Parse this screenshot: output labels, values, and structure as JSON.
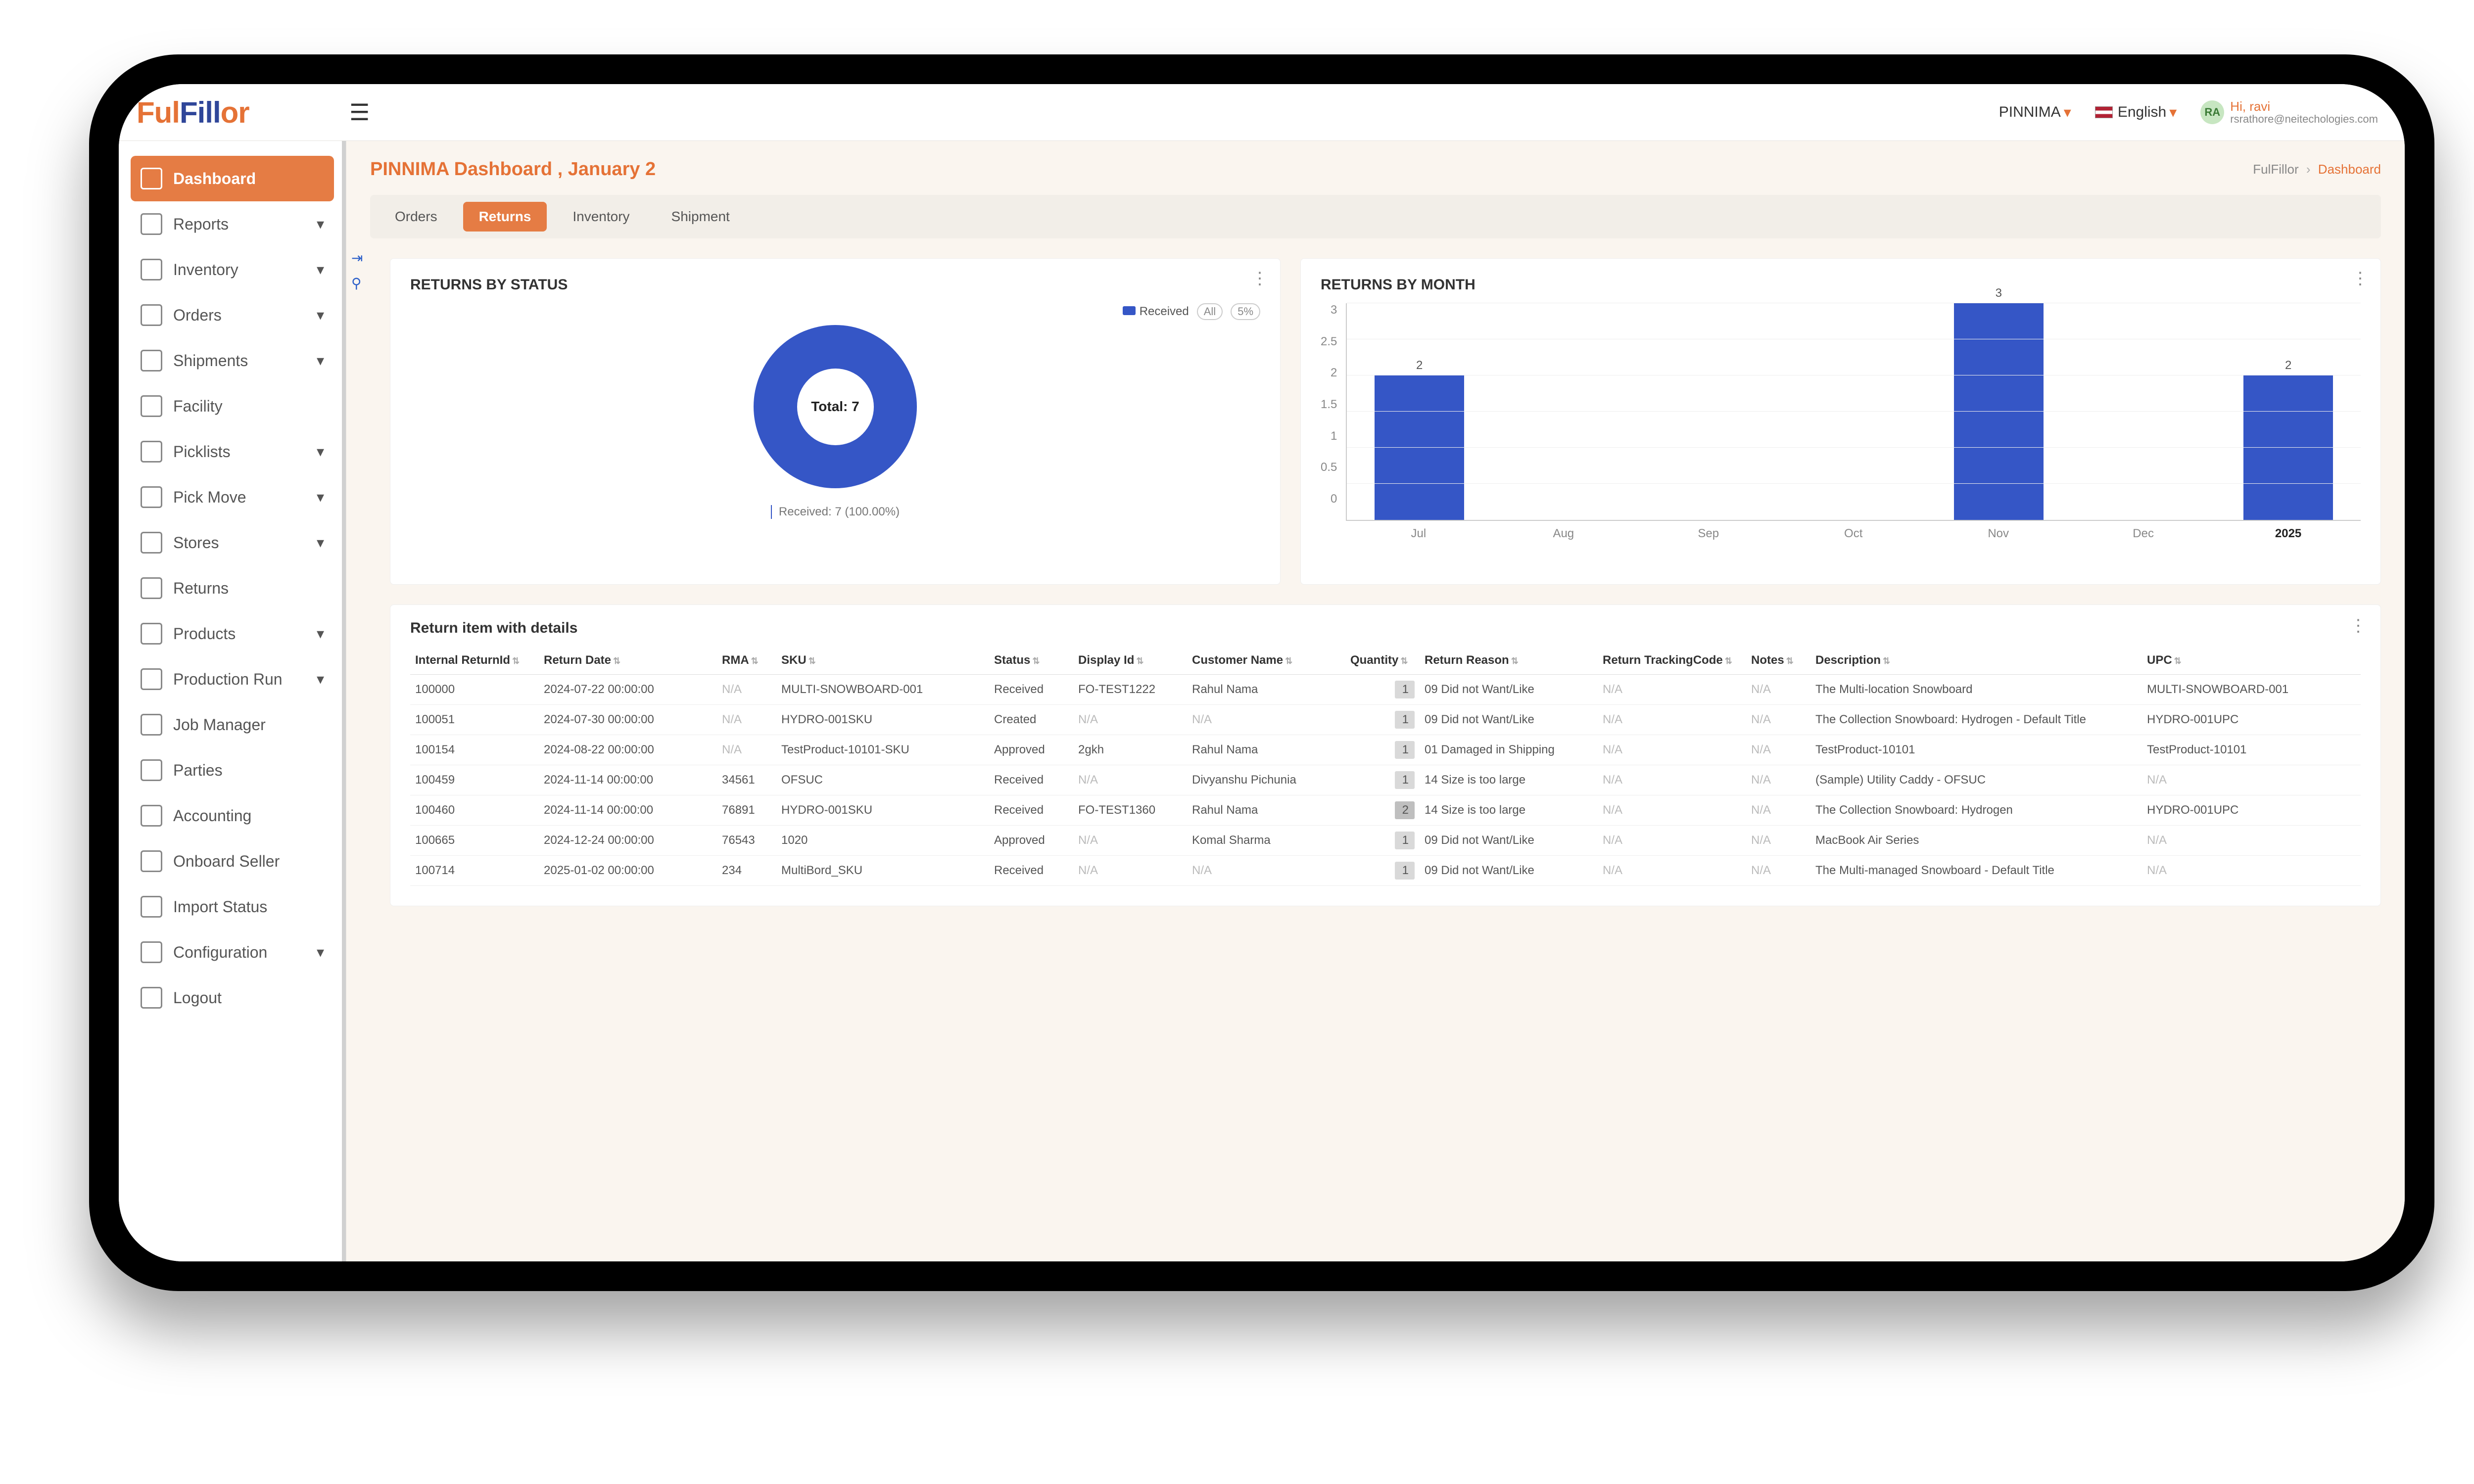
{
  "brand": {
    "p1": "Ful",
    "p2": "Fill",
    "p3": "or"
  },
  "topbar": {
    "tenant": "PINNIMA",
    "language": "English",
    "user_hi": "Hi, ravi",
    "user_email": "rsrathore@neitechologies.com",
    "user_initials": "RA"
  },
  "sidebar": {
    "items": [
      {
        "label": "Dashboard",
        "expandable": false,
        "active": true
      },
      {
        "label": "Reports",
        "expandable": true
      },
      {
        "label": "Inventory",
        "expandable": true
      },
      {
        "label": "Orders",
        "expandable": true
      },
      {
        "label": "Shipments",
        "expandable": true
      },
      {
        "label": "Facility",
        "expandable": false
      },
      {
        "label": "Picklists",
        "expandable": true
      },
      {
        "label": "Pick Move",
        "expandable": true
      },
      {
        "label": "Stores",
        "expandable": true
      },
      {
        "label": "Returns",
        "expandable": false
      },
      {
        "label": "Products",
        "expandable": true
      },
      {
        "label": "Production Run",
        "expandable": true
      },
      {
        "label": "Job Manager",
        "expandable": false
      },
      {
        "label": "Parties",
        "expandable": false
      },
      {
        "label": "Accounting",
        "expandable": false
      },
      {
        "label": "Onboard Seller",
        "expandable": false
      },
      {
        "label": "Import Status",
        "expandable": false
      },
      {
        "label": "Configuration",
        "expandable": true
      },
      {
        "label": "Logout",
        "expandable": false
      }
    ]
  },
  "page": {
    "title": "PINNIMA Dashboard , January 2",
    "breadcrumb_root": "FulFillor",
    "breadcrumb_current": "Dashboard"
  },
  "tabs": [
    {
      "label": "Orders",
      "active": false
    },
    {
      "label": "Returns",
      "active": true
    },
    {
      "label": "Inventory",
      "active": false
    },
    {
      "label": "Shipment",
      "active": false
    }
  ],
  "status_card": {
    "title": "RETURNS BY STATUS",
    "legend_label": "Received",
    "pill_all": "All",
    "pill_pct": "5%",
    "center_text": "Total: 7",
    "caption": "Received: 7 (100.00%)"
  },
  "month_card": {
    "title": "RETURNS BY MONTH"
  },
  "chart_data": [
    {
      "type": "pie",
      "title": "RETURNS BY STATUS",
      "series": [
        {
          "name": "Received",
          "values": [
            7
          ]
        }
      ],
      "categories": [
        "Received"
      ],
      "total": 7
    },
    {
      "type": "bar",
      "title": "RETURNS BY MONTH",
      "categories": [
        "Jul",
        "Aug",
        "Sep",
        "Oct",
        "Nov",
        "Dec",
        "2025"
      ],
      "values": [
        2,
        0,
        0,
        0,
        3,
        0,
        2
      ],
      "xlabel": "",
      "ylabel": "",
      "ylim": [
        0,
        3
      ],
      "y_ticks": [
        0,
        0.5,
        1,
        1.5,
        2,
        2.5,
        3
      ]
    }
  ],
  "table": {
    "title": "Return item with details",
    "columns": [
      "Internal ReturnId",
      "Return Date",
      "RMA",
      "SKU",
      "Status",
      "Display Id",
      "Customer Name",
      "Quantity",
      "Return Reason",
      "Return TrackingCode",
      "Notes",
      "Description",
      "UPC"
    ],
    "rows": [
      {
        "ir": "100000",
        "rd": "2024-07-22 00:00:00",
        "rma": "N/A",
        "sku": "MULTI-SNOWBOARD-001",
        "st": "Received",
        "di": "FO-TEST1222",
        "cn": "Rahul Nama",
        "qt": 1,
        "rr": "09 Did not Want/Like",
        "tc": "N/A",
        "nt": "N/A",
        "ds": "The Multi-location Snowboard",
        "upc": "MULTI-SNOWBOARD-001"
      },
      {
        "ir": "100051",
        "rd": "2024-07-30 00:00:00",
        "rma": "N/A",
        "sku": "HYDRO-001SKU",
        "st": "Created",
        "di": "N/A",
        "cn": "N/A",
        "qt": 1,
        "rr": "09 Did not Want/Like",
        "tc": "N/A",
        "nt": "N/A",
        "ds": "The Collection Snowboard: Hydrogen - Default Title",
        "upc": "HYDRO-001UPC"
      },
      {
        "ir": "100154",
        "rd": "2024-08-22 00:00:00",
        "rma": "N/A",
        "sku": "TestProduct-10101-SKU",
        "st": "Approved",
        "di": "2gkh",
        "cn": "Rahul Nama",
        "qt": 1,
        "rr": "01 Damaged in Shipping",
        "tc": "N/A",
        "nt": "N/A",
        "ds": "TestProduct-10101",
        "upc": "TestProduct-10101"
      },
      {
        "ir": "100459",
        "rd": "2024-11-14 00:00:00",
        "rma": "34561",
        "sku": "OFSUC",
        "st": "Received",
        "di": "N/A",
        "cn": "Divyanshu Pichunia",
        "qt": 1,
        "rr": "14 Size is too large",
        "tc": "N/A",
        "nt": "N/A",
        "ds": "(Sample) Utility Caddy - OFSUC",
        "upc": "N/A"
      },
      {
        "ir": "100460",
        "rd": "2024-11-14 00:00:00",
        "rma": "76891",
        "sku": "HYDRO-001SKU",
        "st": "Received",
        "di": "FO-TEST1360",
        "cn": "Rahul Nama",
        "qt": 2,
        "rr": "14 Size is too large",
        "tc": "N/A",
        "nt": "N/A",
        "ds": "The Collection Snowboard: Hydrogen",
        "upc": "HYDRO-001UPC"
      },
      {
        "ir": "100665",
        "rd": "2024-12-24 00:00:00",
        "rma": "76543",
        "sku": "1020",
        "st": "Approved",
        "di": "N/A",
        "cn": "Komal Sharma",
        "qt": 1,
        "rr": "09 Did not Want/Like",
        "tc": "N/A",
        "nt": "N/A",
        "ds": "MacBook Air Series",
        "upc": "N/A"
      },
      {
        "ir": "100714",
        "rd": "2025-01-02 00:00:00",
        "rma": "234",
        "sku": "MultiBord_SKU",
        "st": "Received",
        "di": "N/A",
        "cn": "N/A",
        "qt": 1,
        "rr": "09 Did not Want/Like",
        "tc": "N/A",
        "nt": "N/A",
        "ds": "The Multi-managed Snowboard - Default Title",
        "upc": "N/A"
      }
    ]
  }
}
